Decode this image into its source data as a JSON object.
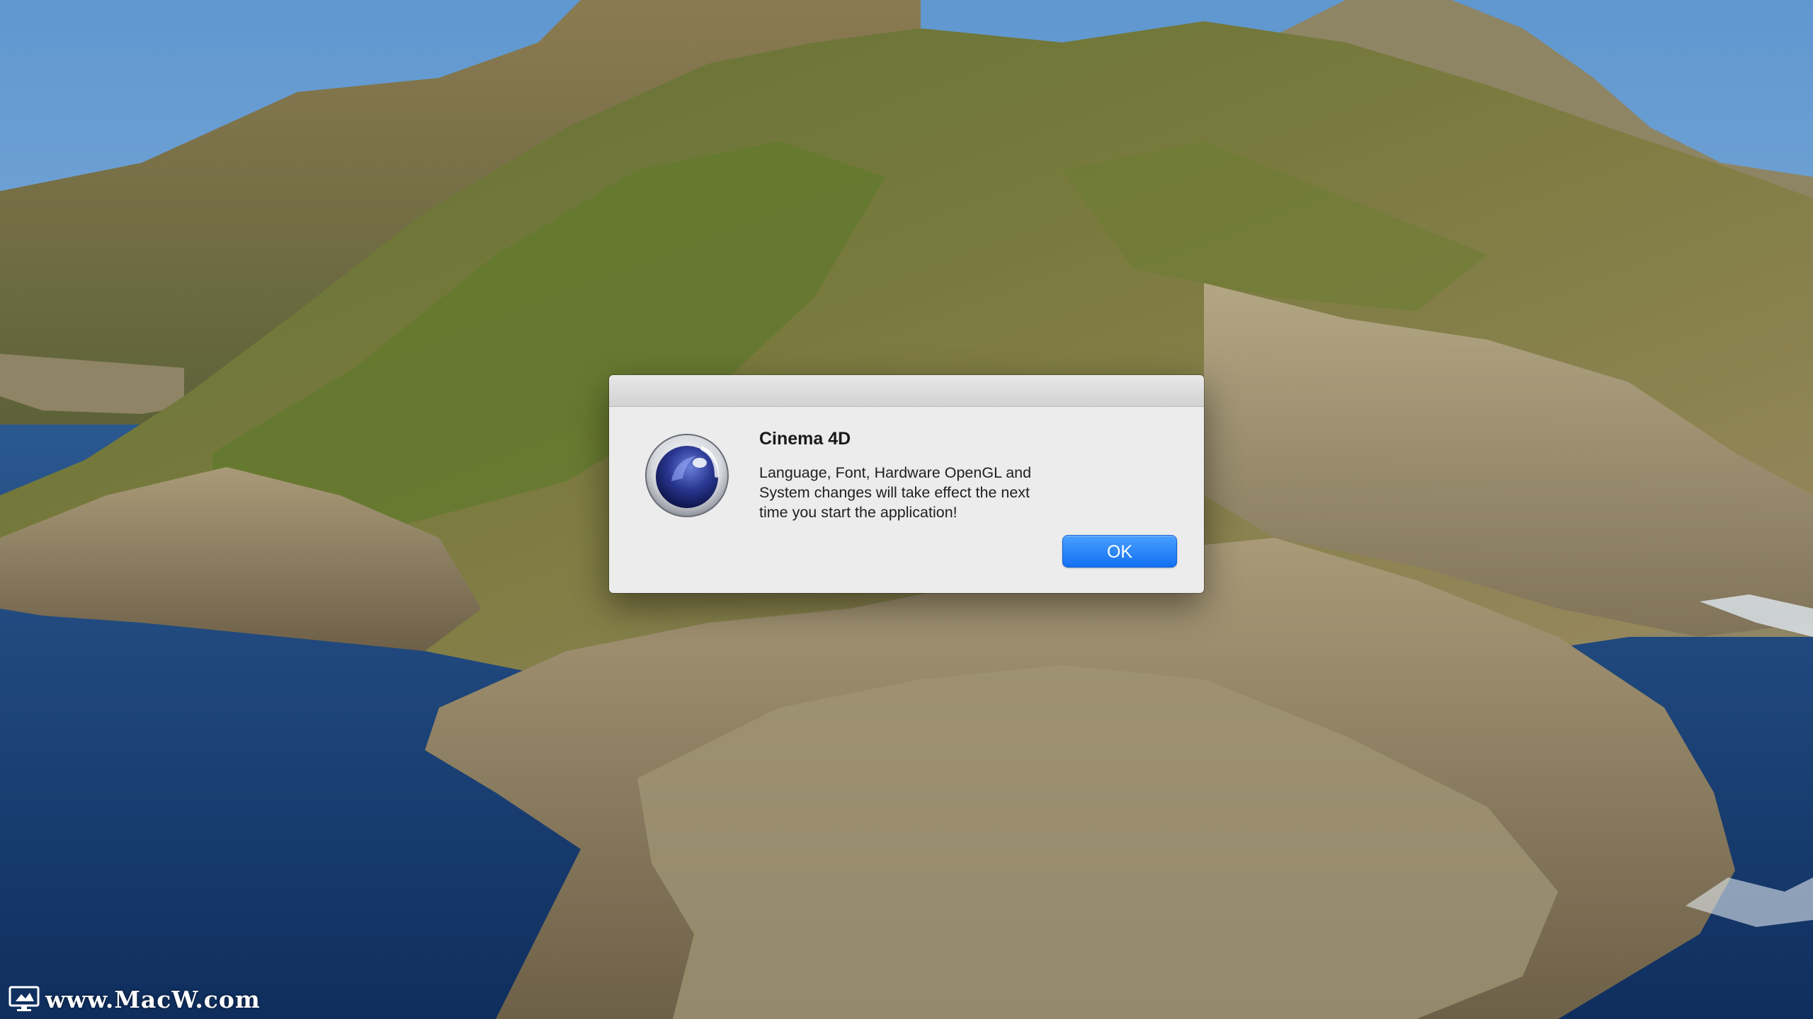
{
  "dialog": {
    "title": "Cinema 4D",
    "message": "Language, Font, Hardware OpenGL and\nSystem changes will take effect the next\ntime you start the application!",
    "ok_label": "OK",
    "icon": "cinema-4d-icon"
  },
  "watermark": {
    "text": "www.MacW.com",
    "icon": "monitor-icon"
  },
  "colors": {
    "accent_button": "#1a78f5",
    "dialog_bg": "#ececec"
  }
}
